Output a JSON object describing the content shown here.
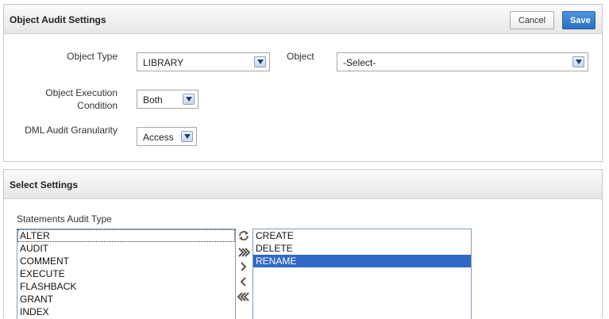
{
  "object_audit": {
    "title": "Object Audit Settings",
    "cancel_label": "Cancel",
    "save_label": "Save",
    "fields": {
      "object_type": {
        "label": "Object Type",
        "value": "LIBRARY"
      },
      "object": {
        "label": "Object",
        "value": "-Select-"
      },
      "execution_condition": {
        "label_line1": "Object Execution",
        "label_line2": "Condition",
        "value": "Both"
      },
      "dml_granularity": {
        "label": "DML Audit Granularity",
        "value": "Access"
      }
    }
  },
  "select_settings": {
    "title": "Select Settings",
    "statements_label": "Statements Audit Type",
    "available": [
      "ALTER",
      "AUDIT",
      "COMMENT",
      "EXECUTE",
      "FLASHBACK",
      "GRANT",
      "INDEX"
    ],
    "selected": [
      "CREATE",
      "DELETE",
      "RENAME"
    ],
    "highlighted_selected": "RENAME",
    "focused_available": "ALTER",
    "shuttle_icons": [
      "reset-icon",
      "move-all-icon",
      "move-icon",
      "remove-icon",
      "remove-all-icon"
    ]
  },
  "colors": {
    "save_button": "#2a6fc4",
    "selected_option": "#3169c6",
    "header_gradient_top": "#fbfbfb",
    "header_gradient_bottom": "#e6e6e6"
  }
}
